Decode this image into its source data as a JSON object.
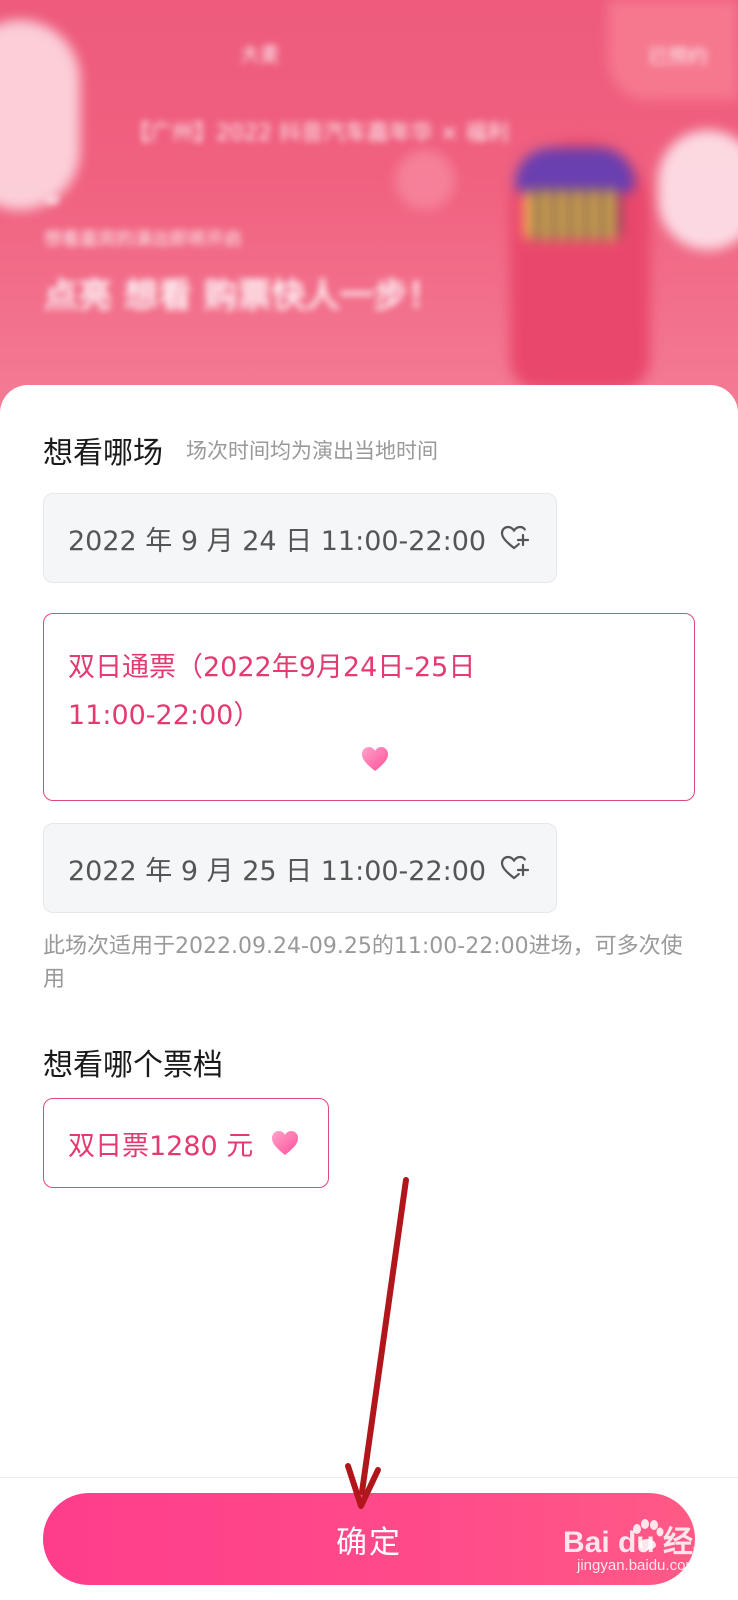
{
  "banner": {
    "logo_text": "大麦",
    "status_text": "已预约",
    "event_title": "【广州】2022 抖音汽车嘉年华 × 福利",
    "quote_mark": "“",
    "subtitle": "想看嘉宾的演出即将开启",
    "slogan": "点亮 想看 购票快人一步！"
  },
  "session_section": {
    "title": "想看哪场",
    "hint": "场次时间均为演出当地时间",
    "options": [
      {
        "label": "2022 年 9 月 24 日 11:00-22:00",
        "selected": false
      },
      {
        "label_line1": "双日通票（2022年9月24日-25日",
        "label_line2": "11:00-22:00）",
        "selected": true
      },
      {
        "label": "2022 年 9 月 25 日 11:00-22:00",
        "selected": false
      }
    ],
    "note": "此场次适用于2022.09.24-09.25的11:00-22:00进场，可多次使用"
  },
  "ticket_section": {
    "title": "想看哪个票档",
    "options": [
      {
        "label": "双日票1280 元",
        "selected": true
      }
    ]
  },
  "confirm_button": {
    "label": "确定"
  },
  "watermark": {
    "main": "Bai du 经验",
    "sub": "jingyan.baidu.com"
  },
  "colors": {
    "accent": "#e33a70",
    "button_start": "#ff3d8b",
    "button_end": "#ff5a86",
    "annotation_arrow": "#b0161c"
  },
  "icons": {
    "heart_plus": "heart-plus-icon",
    "heart_filled": "heart-filled-icon",
    "arrow": "annotation-arrow"
  }
}
